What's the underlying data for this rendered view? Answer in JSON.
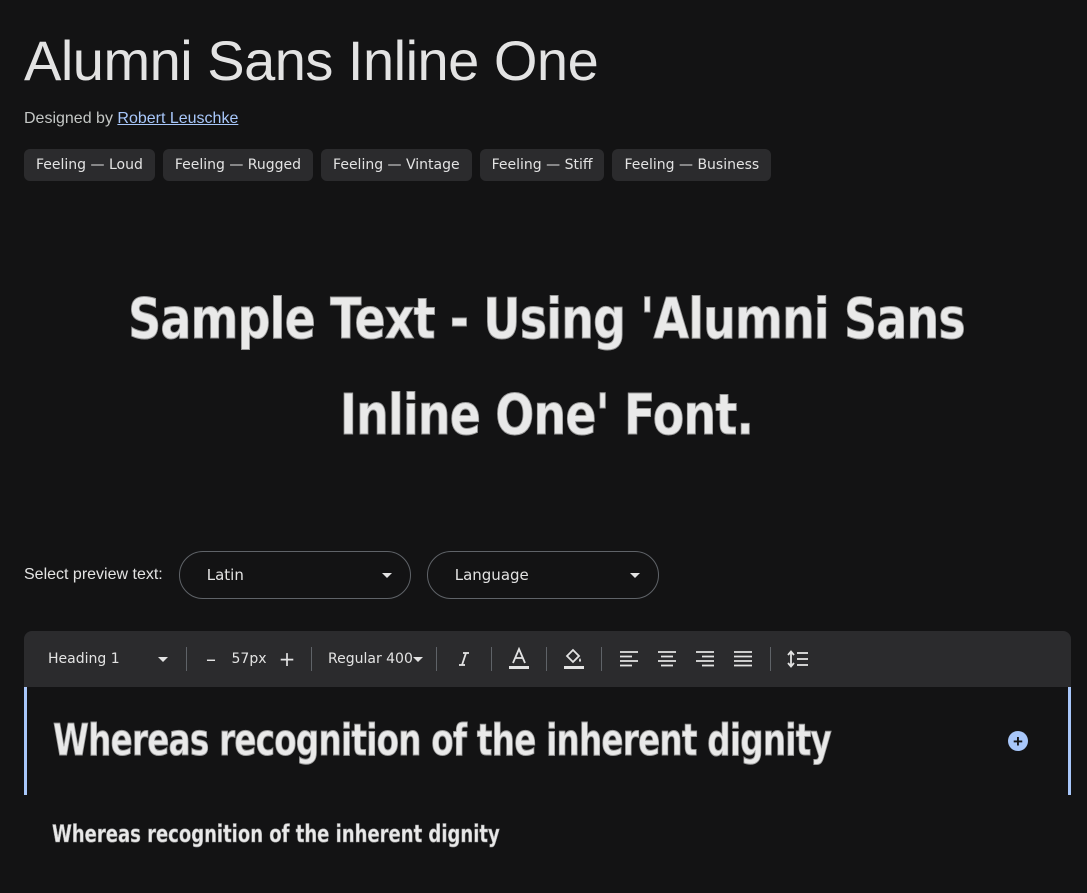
{
  "header": {
    "title": "Alumni Sans Inline One",
    "designed_by_prefix": "Designed by ",
    "designer": "Robert Leuschke"
  },
  "tags": [
    "Feeling — Loud",
    "Feeling — Rugged",
    "Feeling — Vintage",
    "Feeling — Stiff",
    "Feeling — Business"
  ],
  "hero": {
    "text": "Sample Text - Using 'Alumni Sans Inline One' Font."
  },
  "preview": {
    "label": "Select preview text:",
    "script_value": "Latin",
    "language_value": "Language"
  },
  "toolbar": {
    "style_value": "Heading 1",
    "decrease_label": "–",
    "size_value": "57px",
    "increase_label": "+",
    "weight_value": "Regular 400",
    "icons": [
      "italic-icon",
      "text-color-icon",
      "highlight-color-icon",
      "align-left-icon",
      "align-center-icon",
      "align-right-icon",
      "align-justify-icon",
      "line-spacing-icon"
    ]
  },
  "editor": {
    "text": "Whereas recognition of the inherent dignity",
    "add_label": "+"
  },
  "sample": {
    "text": "Whereas recognition of the inherent dignity"
  },
  "colors": {
    "background": "#131314",
    "accent": "#a8c7fa",
    "toolbar": "#2b2b2d"
  }
}
